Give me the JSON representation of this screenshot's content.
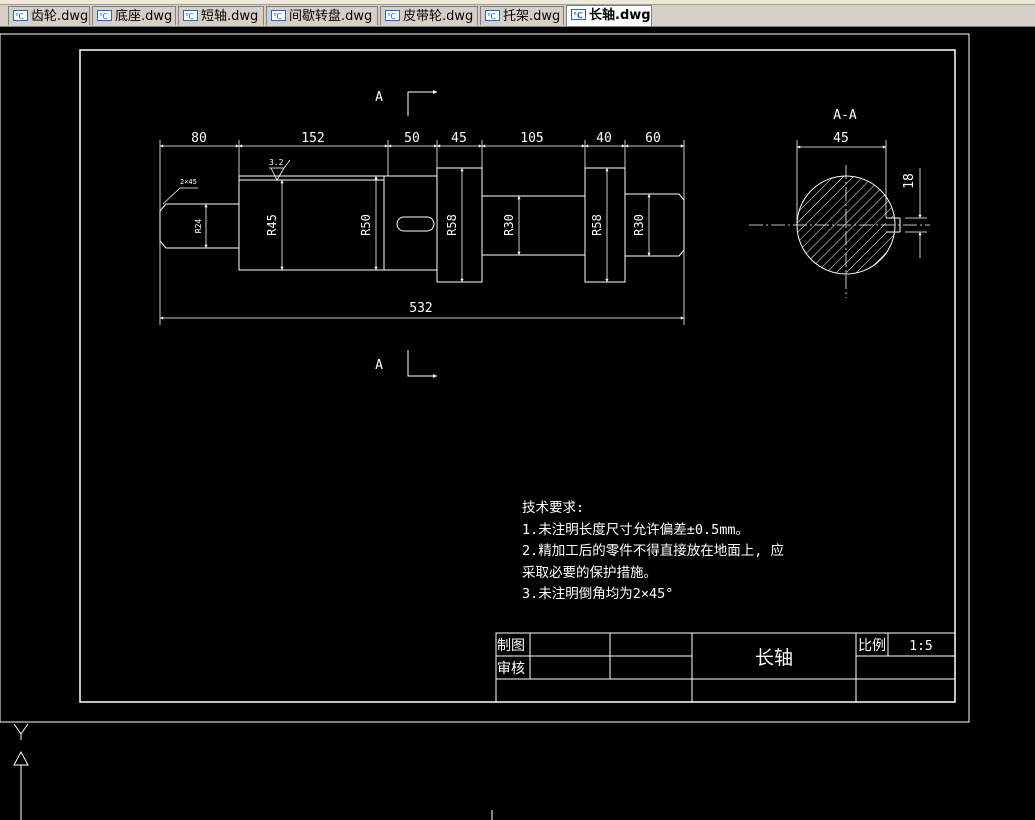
{
  "tabs": [
    {
      "label": "齿轮.dwg",
      "active": false
    },
    {
      "label": "底座.dwg",
      "active": false
    },
    {
      "label": "短轴.dwg",
      "active": false
    },
    {
      "label": "间歇转盘.dwg",
      "active": false
    },
    {
      "label": "皮带轮.dwg",
      "active": false
    },
    {
      "label": "托架.dwg",
      "active": false
    },
    {
      "label": "长轴.dwg",
      "active": true
    }
  ],
  "drawing": {
    "section_marker": "A",
    "section_label": "A-A",
    "dims_top": [
      "80",
      "152",
      "50",
      "45",
      "105",
      "40",
      "60"
    ],
    "overall_length": "532",
    "chamfer_note": "2×45",
    "roughness": "3.2",
    "radii": [
      "R24",
      "R45",
      "R50",
      "R58",
      "R30",
      "R58",
      "R30"
    ],
    "section_width": "45",
    "section_depth": "18"
  },
  "tech_req": {
    "title": "技术要求:",
    "line1": "1.未注明长度尺寸允许偏差±0.5mm。",
    "line2": "2.精加工后的零件不得直接放在地面上, 应",
    "line3": "采取必要的保护措施。",
    "line4": "3.未注明倒角均为2×45°"
  },
  "title_block": {
    "drawn_by": "制图",
    "checked_by": "审核",
    "part_name": "长轴",
    "scale_label": "比例",
    "scale_value": "1:5"
  },
  "colors": {
    "background": "#000000",
    "lines": "#ffffff",
    "tab_bar": "#d4d0c8",
    "icon_blue": "#2a62c9"
  }
}
